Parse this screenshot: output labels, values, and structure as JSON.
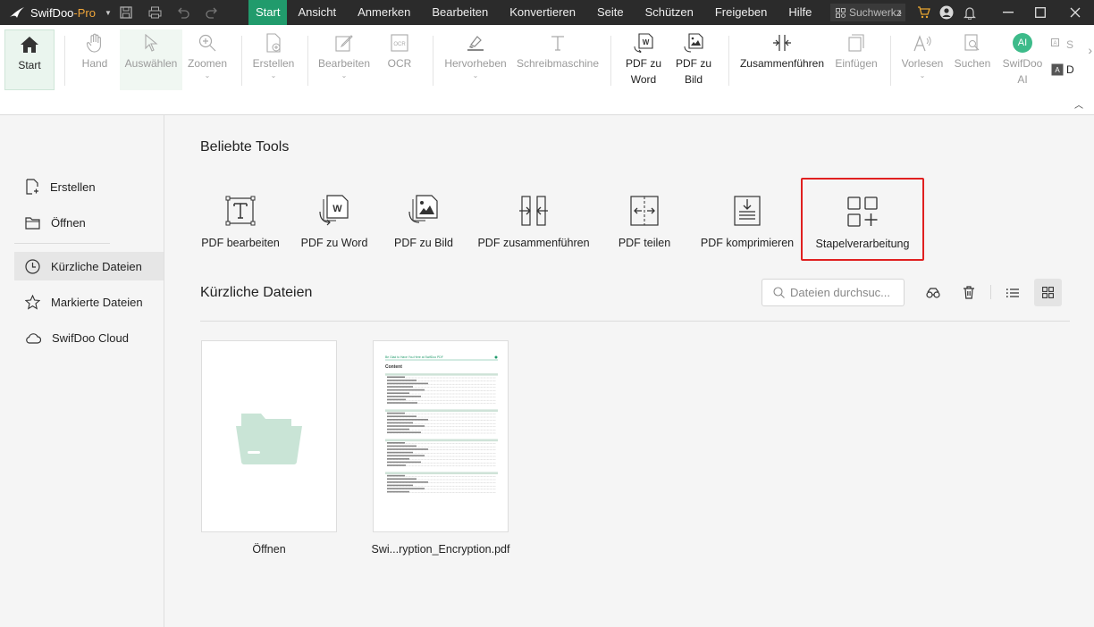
{
  "app": {
    "name_main": "SwifDoo",
    "name_suffix": "-Pro"
  },
  "colors": {
    "accent": "#219b6c",
    "titlebar": "#2b2b2b",
    "highlight_box": "#e02020",
    "folder": "#c9e4d6"
  },
  "menu": [
    "Start",
    "Ansicht",
    "Anmerken",
    "Bearbeiten",
    "Konvertieren",
    "Seite",
    "Schützen",
    "Freigeben",
    "Hilfe"
  ],
  "title_search": {
    "placeholder": "Suchwerkz"
  },
  "ribbon": {
    "start": "Start",
    "hand": "Hand",
    "auswaehlen": "Auswählen",
    "zoomen": "Zoomen",
    "erstellen": "Erstellen",
    "bearbeiten": "Bearbeiten",
    "ocr": "OCR",
    "hervorheben": "Hervorheben",
    "schreibmaschine": "Schreibmaschine",
    "pdf_word_1": "PDF zu",
    "pdf_word_2": "Word",
    "pdf_bild_1": "PDF zu",
    "pdf_bild_2": "Bild",
    "zusammenfuehren": "Zusammenführen",
    "einfuegen": "Einfügen",
    "vorlesen": "Vorlesen",
    "suchen": "Suchen",
    "ai_1": "SwifDoo",
    "ai_2": "AI",
    "ai_badge": "AI",
    "more_1": "S",
    "more_2": "D"
  },
  "sidebar": {
    "erstellen": "Erstellen",
    "oeffnen": "Öffnen",
    "kuerzliche": "Kürzliche Dateien",
    "markierte": "Markierte Dateien",
    "cloud": "SwifDoo Cloud"
  },
  "main": {
    "popular_title": "Beliebte Tools",
    "tools": {
      "pdf_bearbeiten": "PDF bearbeiten",
      "pdf_zu_word": "PDF zu Word",
      "pdf_zu_bild": "PDF zu Bild",
      "pdf_zusammenfuehren": "PDF zusammenführen",
      "pdf_teilen": "PDF teilen",
      "pdf_komprimieren": "PDF komprimieren",
      "stapelverarbeitung": "Stapelverarbeitung"
    },
    "recent_title": "Kürzliche Dateien",
    "search_placeholder": "Dateien durchsuc...",
    "open_label": "Öffnen",
    "file_label": "Swi...ryption_Encryption.pdf",
    "thumb_header": "Be Glad to Have You Here at SwifDoo PDF",
    "thumb_heading": "Content"
  }
}
